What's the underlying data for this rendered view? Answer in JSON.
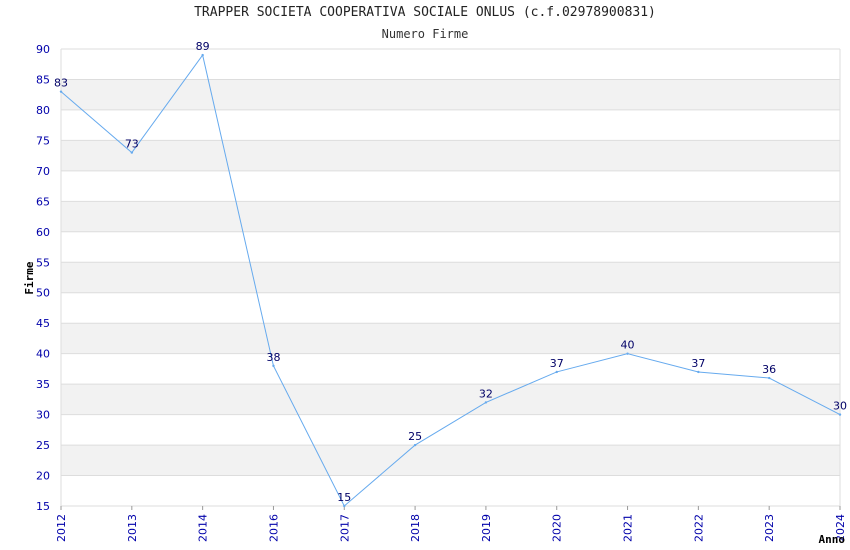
{
  "chart_data": {
    "type": "line",
    "title": "TRAPPER SOCIETA COOPERATIVA SOCIALE ONLUS (c.f.02978900831)",
    "subtitle": "Numero Firme",
    "xlabel": "Anno",
    "ylabel": "Firme",
    "ylim": [
      15,
      90
    ],
    "yticks": [
      "15",
      "20",
      "25",
      "30",
      "35",
      "40",
      "45",
      "50",
      "55",
      "60",
      "65",
      "70",
      "75",
      "80",
      "85",
      "90"
    ],
    "categories": [
      "2012",
      "2013",
      "2014",
      "2016",
      "2017",
      "2018",
      "2019",
      "2020",
      "2021",
      "2022",
      "2023",
      "2024"
    ],
    "series": [
      {
        "values": [
          83,
          73,
          89,
          38,
          15,
          25,
          32,
          37,
          40,
          37,
          36,
          30
        ]
      }
    ],
    "grid": true,
    "colors": {
      "line": "#66aaee",
      "band": "#f2f2f2",
      "grid": "#dddddd",
      "tick": "#0000aa",
      "label": "#000066"
    }
  }
}
